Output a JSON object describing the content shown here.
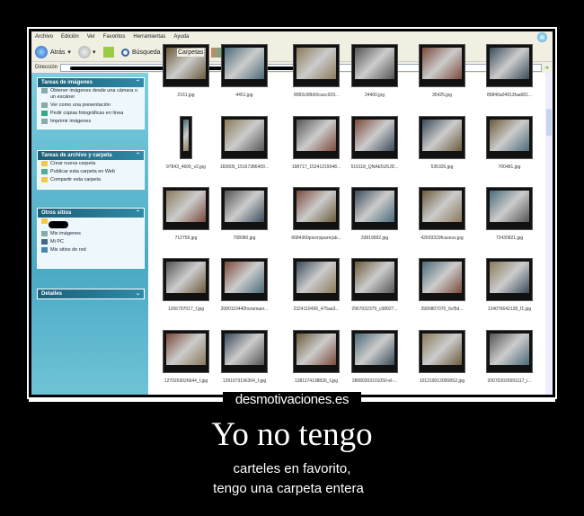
{
  "window": {
    "menu": [
      "Archivo",
      "Edición",
      "Ver",
      "Favoritos",
      "Herramientas",
      "Ayuda"
    ],
    "toolbar": {
      "back": "Atrás",
      "search": "Búsqueda",
      "folders": "Carpetas"
    },
    "address_label": "Dirección"
  },
  "sidebar": {
    "image_tasks": {
      "title": "Tareas de imágenes",
      "items": [
        "Obtener imágenes desde una cámara o un escáner",
        "Ver como una presentación",
        "Pedir copias fotográficas en línea",
        "Imprimir imágenes"
      ]
    },
    "file_tasks": {
      "title": "Tareas de archivo y carpeta",
      "items": [
        "Crear nueva carpeta",
        "Publicar esta carpeta en Web",
        "Compartir esta carpeta"
      ]
    },
    "other_places": {
      "title": "Otros sitios",
      "items": [
        "Mis imágenes",
        "Mi PC",
        "Mis sitios de red"
      ]
    },
    "details": {
      "title": "Detalles"
    }
  },
  "files": [
    [
      "2161.jpg",
      "4451.jpg",
      "9083c08b50cacc929...",
      "24400.jpg",
      "35425.jpg",
      "85846a04913faa681..."
    ],
    [
      "97843_4606_v2.jpg",
      "183605_15167386409...",
      "198717_15241219048...",
      "516118_QNAE5U5JD...",
      "535326.jpg",
      "700481.jpg"
    ],
    [
      "712759.jpg",
      "708080.jpg",
      "6684360picenspare(ab...",
      "33819992.jpg",
      "42603329fcaxess.jpg",
      "72430821.jpg"
    ],
    [
      "1206797017_f.jpg",
      "2080110440horamaer...",
      "2324110499_475aa3...",
      "2967032379_c08927...",
      "3990807070_6cf5d...",
      "124076642128_f1.jpg"
    ],
    [
      "1270263026644_f.jpg",
      "1291973196304_f.jpg",
      "1381174138826_f.jpg",
      "28080203101050-el-...",
      "1012190120008S2.jpg",
      "200702020591117_i..."
    ]
  ],
  "watermark": "desmotivaciones.es",
  "poster": {
    "title": "Yo no tengo",
    "caption_line1": "carteles en favorito,",
    "caption_line2": "tengo una carpeta entera"
  }
}
